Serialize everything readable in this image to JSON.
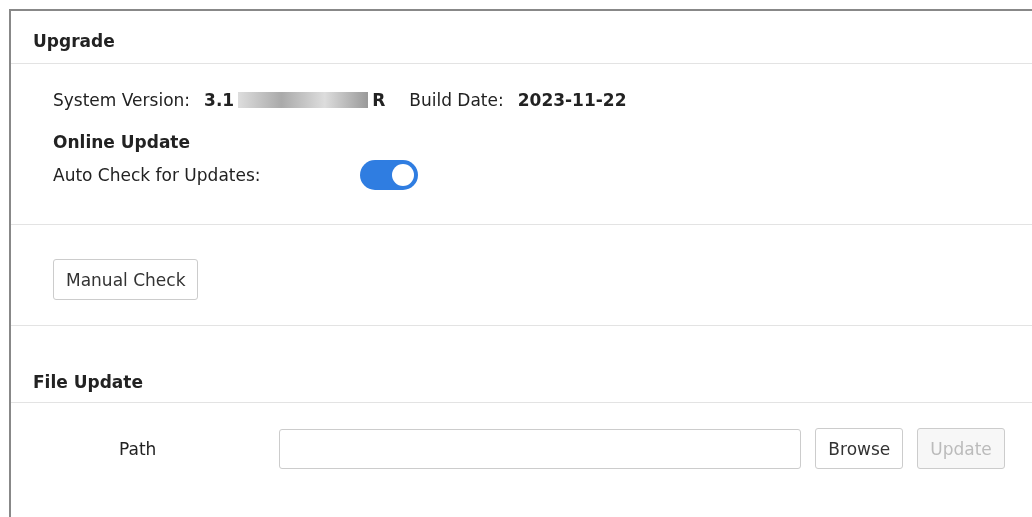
{
  "panel": {
    "title": "Upgrade"
  },
  "version": {
    "label": "System Version:",
    "value_start": "3.1",
    "value_end": "R",
    "redacted": true,
    "build_label": "Build Date:",
    "build_value": "2023-11-22"
  },
  "online_update": {
    "title": "Online Update",
    "auto_check_label": "Auto Check for Updates:",
    "auto_check_on": true,
    "manual_button": "Manual Check"
  },
  "file_update": {
    "title": "File Update",
    "path_label": "Path",
    "browse_button": "Browse",
    "update_button": "Update",
    "update_disabled": true
  }
}
